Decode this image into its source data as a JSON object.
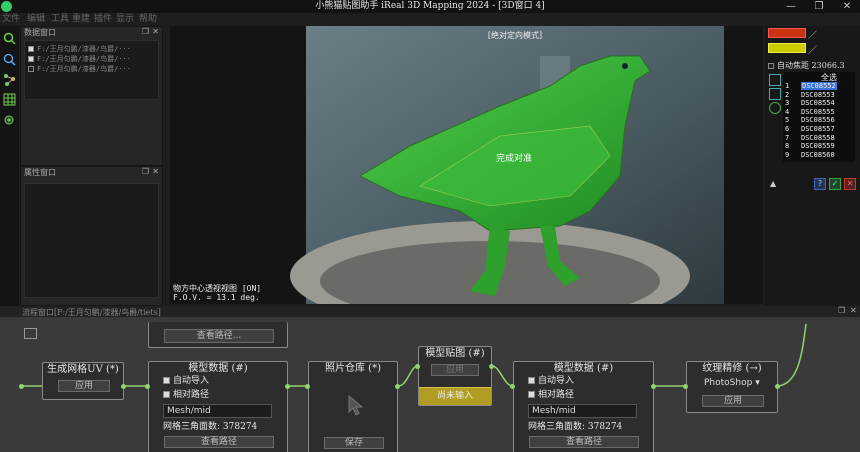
{
  "title": "小熊猫贴图助手 iReal 3D Mapping 2024 - [3D窗口 4]",
  "window_controls": {
    "minimize": "—",
    "maximize": "❐",
    "close": "✕"
  },
  "menu": [
    "文件",
    "编辑",
    "工具",
    "重建",
    "插件",
    "显示",
    "帮助"
  ],
  "data_window": {
    "title": "数据窗口",
    "items": [
      {
        "checked": true,
        "label": "F:/王月匀鹏/漆器/鸟爵/···"
      },
      {
        "checked": true,
        "label": "F:/王月匀鹏/漆器/鸟爵/···"
      },
      {
        "checked": false,
        "label": "F:/王月匀鹏/漆器/鸟爵/···"
      }
    ]
  },
  "property_window": {
    "title": "属性窗口"
  },
  "viewport": {
    "mode_label": "[绝对定向模式]",
    "status_text": "完成对准",
    "info_line1": "物方中心透视视图 [ON]",
    "info_line2": "F.O.V. = 13.1 deg."
  },
  "right_panel": {
    "focus_label": "自动焦距",
    "focus_value": "23066.3",
    "select_all": "全选",
    "photos": [
      {
        "num": "1",
        "name": "DSC08552",
        "selected": true
      },
      {
        "num": "2",
        "name": "DSC08553",
        "selected": false
      },
      {
        "num": "3",
        "name": "DSC08554",
        "selected": false
      },
      {
        "num": "4",
        "name": "DSC08555",
        "selected": false
      },
      {
        "num": "5",
        "name": "DSC08556",
        "selected": false
      },
      {
        "num": "6",
        "name": "DSC08557",
        "selected": false
      },
      {
        "num": "7",
        "name": "DSC08558",
        "selected": false
      },
      {
        "num": "8",
        "name": "DSC08559",
        "selected": false
      },
      {
        "num": "9",
        "name": "DSC08560",
        "selected": false
      }
    ]
  },
  "flow_window": {
    "title": "流程窗口[F:/王月匀鹏/漆器/鸟爵/tiets]",
    "view_path_button": "查看路径...",
    "nodes": {
      "gen_uv": {
        "title": "生成网格UV (*)",
        "apply": "应用"
      },
      "model1": {
        "title": "模型数据 (#)",
        "auto_import": "自动导入",
        "relative_path": "相对路径",
        "path_value": "Mesh/mid",
        "face_count_label": "网格三角面数:",
        "face_count": "378274",
        "bottom_button": "查看路径"
      },
      "photo_lib": {
        "title": "照片仓库 (*)",
        "save_button": "保存"
      },
      "texture": {
        "title": "模型贴图 (#)",
        "apply": "应用",
        "status": "尚未输入"
      },
      "model2": {
        "title": "模型数据 (#)",
        "auto_import": "自动导入",
        "relative_path": "相对路径",
        "path_value": "Mesh/mid",
        "face_count_label": "网格三角面数:",
        "face_count": "378274",
        "bottom_button": "查看路径"
      },
      "refine": {
        "title": "纹理精修 (→)",
        "option": "PhotoShop",
        "apply": "应用"
      }
    }
  },
  "colors": {
    "accent_green": "#3fae2c",
    "selection_blue": "#3a73d6",
    "node_link": "#8fd36e"
  }
}
